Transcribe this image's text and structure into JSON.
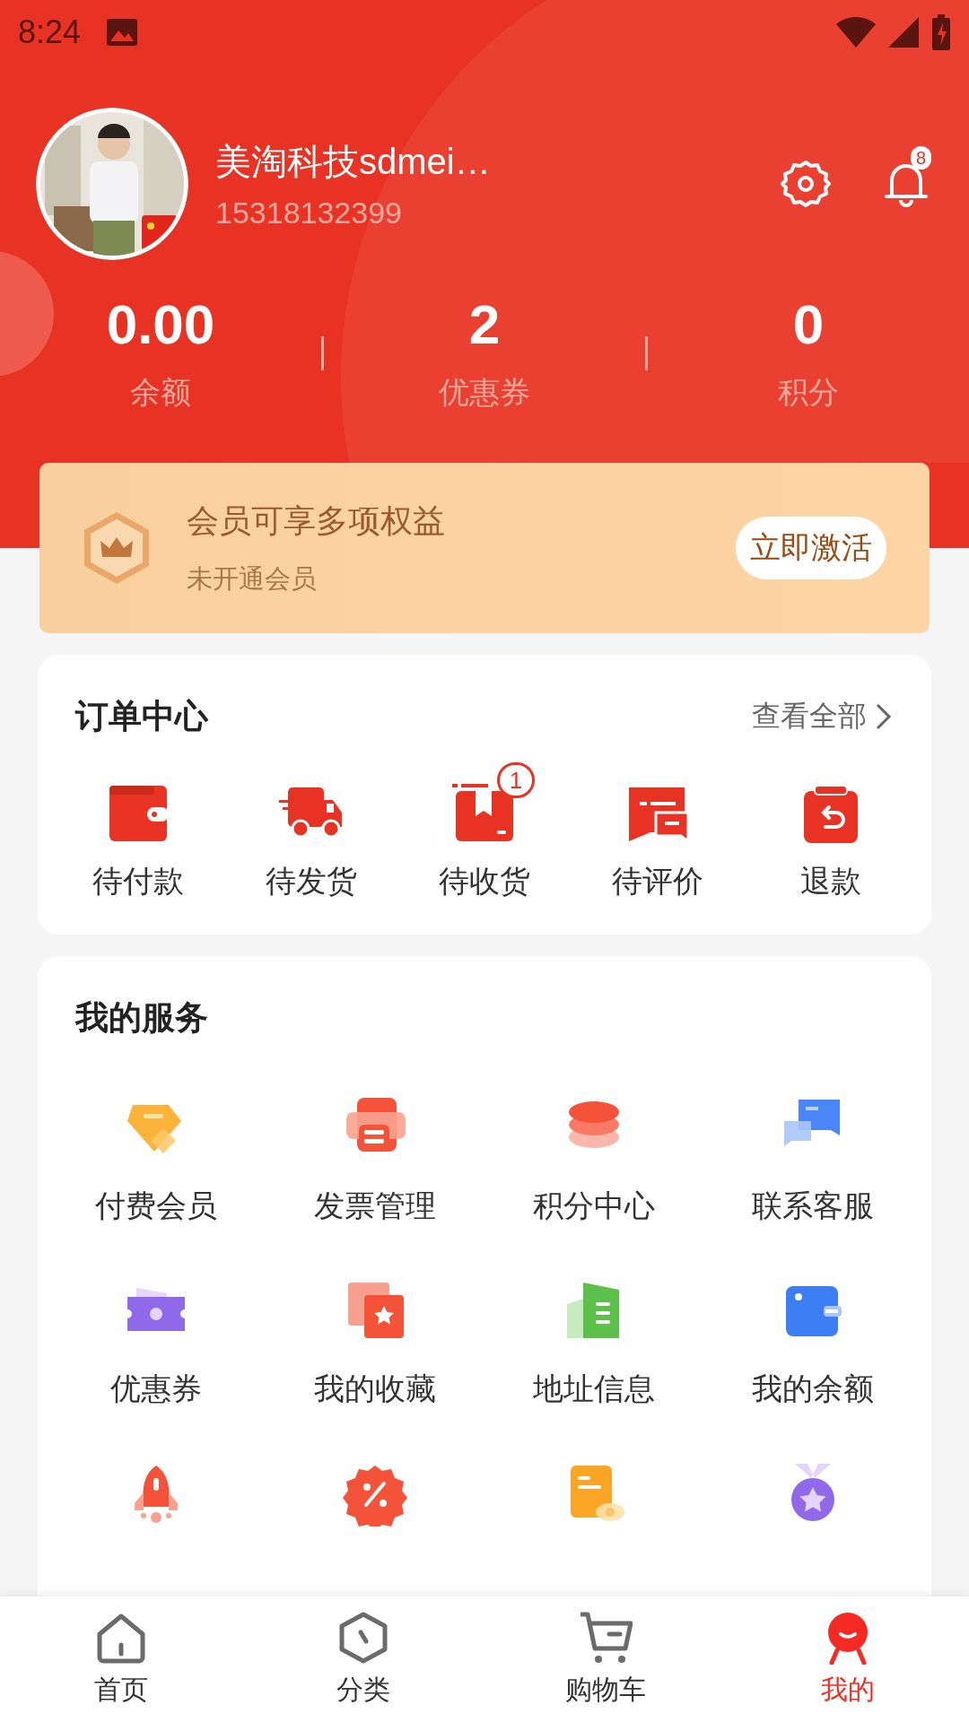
{
  "status_bar": {
    "time": "8:24"
  },
  "profile": {
    "name": "美淘科技sdmei…",
    "phone": "15318132399",
    "notification_count": "8"
  },
  "stats": [
    {
      "value": "0.00",
      "label": "余额"
    },
    {
      "value": "2",
      "label": "优惠券"
    },
    {
      "value": "0",
      "label": "积分"
    }
  ],
  "membership": {
    "title": "会员可享多项权益",
    "subtitle": "未开通会员",
    "button": "立即激活"
  },
  "orders": {
    "title": "订单中心",
    "view_all": "查看全部",
    "items": [
      {
        "kind": "wallet",
        "label": "待付款"
      },
      {
        "kind": "truck",
        "label": "待发货"
      },
      {
        "kind": "box",
        "label": "待收货",
        "badge": "1"
      },
      {
        "kind": "review",
        "label": "待评价"
      },
      {
        "kind": "refund",
        "label": "退款"
      }
    ]
  },
  "services": {
    "title": "我的服务",
    "items": [
      {
        "kind": "diamond",
        "label": "付费会员"
      },
      {
        "kind": "invoice",
        "label": "发票管理"
      },
      {
        "kind": "coins",
        "label": "积分中心"
      },
      {
        "kind": "chat",
        "label": "联系客服"
      },
      {
        "kind": "ticket",
        "label": "优惠券"
      },
      {
        "kind": "favorite",
        "label": "我的收藏"
      },
      {
        "kind": "building",
        "label": "地址信息"
      },
      {
        "kind": "purse",
        "label": "我的余额"
      },
      {
        "kind": "rocket"
      },
      {
        "kind": "discount"
      },
      {
        "kind": "document"
      },
      {
        "kind": "medal"
      }
    ]
  },
  "tab_bar": [
    {
      "kind": "home",
      "label": "首页",
      "selected": false
    },
    {
      "kind": "category",
      "label": "分类",
      "selected": false
    },
    {
      "kind": "cart",
      "label": "购物车",
      "selected": false
    },
    {
      "kind": "me",
      "label": "我的",
      "selected": true
    }
  ]
}
